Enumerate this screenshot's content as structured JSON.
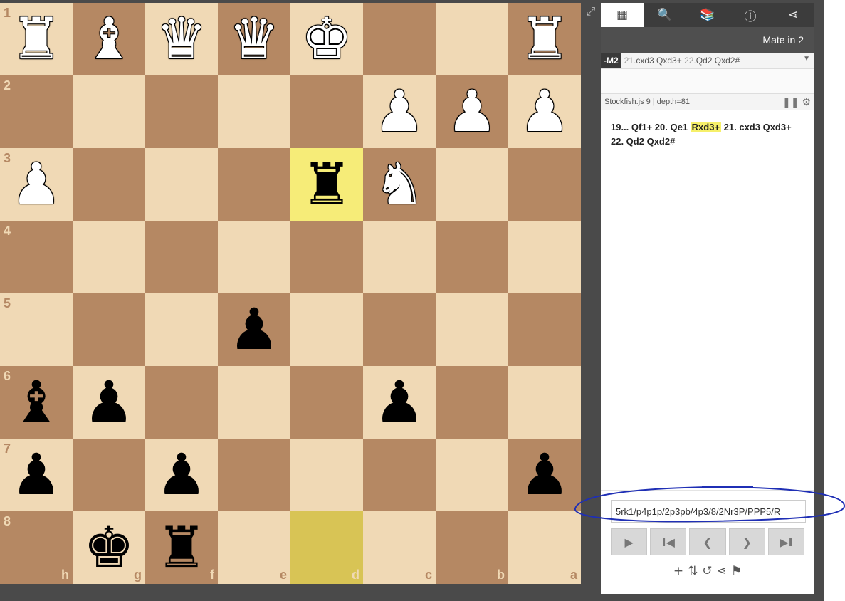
{
  "board": {
    "ranks": [
      "1",
      "2",
      "3",
      "4",
      "5",
      "6",
      "7",
      "8"
    ],
    "files": [
      "h",
      "g",
      "f",
      "e",
      "d",
      "c",
      "b",
      "a"
    ],
    "squares": [
      [
        "R",
        "B",
        "Q",
        "Q",
        "K",
        "",
        "",
        "R"
      ],
      [
        "",
        "",
        "",
        "",
        "",
        "P",
        "P",
        "P"
      ],
      [
        "P",
        "",
        "",
        "",
        "r",
        "N",
        "",
        ""
      ],
      [
        "",
        "",
        "",
        "",
        "",
        "",
        "",
        ""
      ],
      [
        "",
        "",
        "",
        "p",
        "",
        "",
        "",
        ""
      ],
      [
        "b",
        "p",
        "",
        "",
        "",
        "p",
        "",
        ""
      ],
      [
        "p",
        "",
        "p",
        "",
        "",
        "",
        "",
        "p"
      ],
      [
        "",
        "k",
        "r",
        "",
        "",
        "",
        "",
        ""
      ]
    ],
    "highlight_squares": [
      "d3",
      "d8"
    ]
  },
  "expand_icon": "expand-icon",
  "tabs": [
    {
      "icon": "analysis-board-icon",
      "glyph": "▦"
    },
    {
      "icon": "explorer-icon",
      "glyph": "🔍"
    },
    {
      "icon": "opening-book-icon",
      "glyph": "📚"
    },
    {
      "icon": "info-icon",
      "glyph": "ⓘ"
    },
    {
      "icon": "share-icon",
      "glyph": "⋖"
    }
  ],
  "mate_header": "Mate in 2",
  "pv": {
    "badge": "-M2",
    "n1": "21.",
    "m1": "cxd3 Qxd3+",
    "n2": "22.",
    "m2": "Qd2 Qxd2#"
  },
  "engine": {
    "label": "Stockfish.js 9 | depth=81"
  },
  "moves": {
    "a": "19... Qf1+ 20. Qe1 ",
    "hl": "Rxd3+",
    "b": " 21. cxd3 Qxd3+",
    "c": "22. Qd2 Qxd2#"
  },
  "fen": "5rk1/p4p1p/2p3pb/4p3/8/2Nr3P/PPP5/R",
  "nav": {
    "play": "▶",
    "first": "I◀",
    "prev": "❮",
    "next": "❯",
    "last": "▶I"
  },
  "tools": [
    "+",
    "⇅",
    "↺",
    "⋖",
    "⚑"
  ],
  "colors": {
    "light_square": "#f0d9b5",
    "dark_square": "#b58863",
    "highlight": "#f6ec78",
    "annotation_ink": "#1f2fb5"
  }
}
